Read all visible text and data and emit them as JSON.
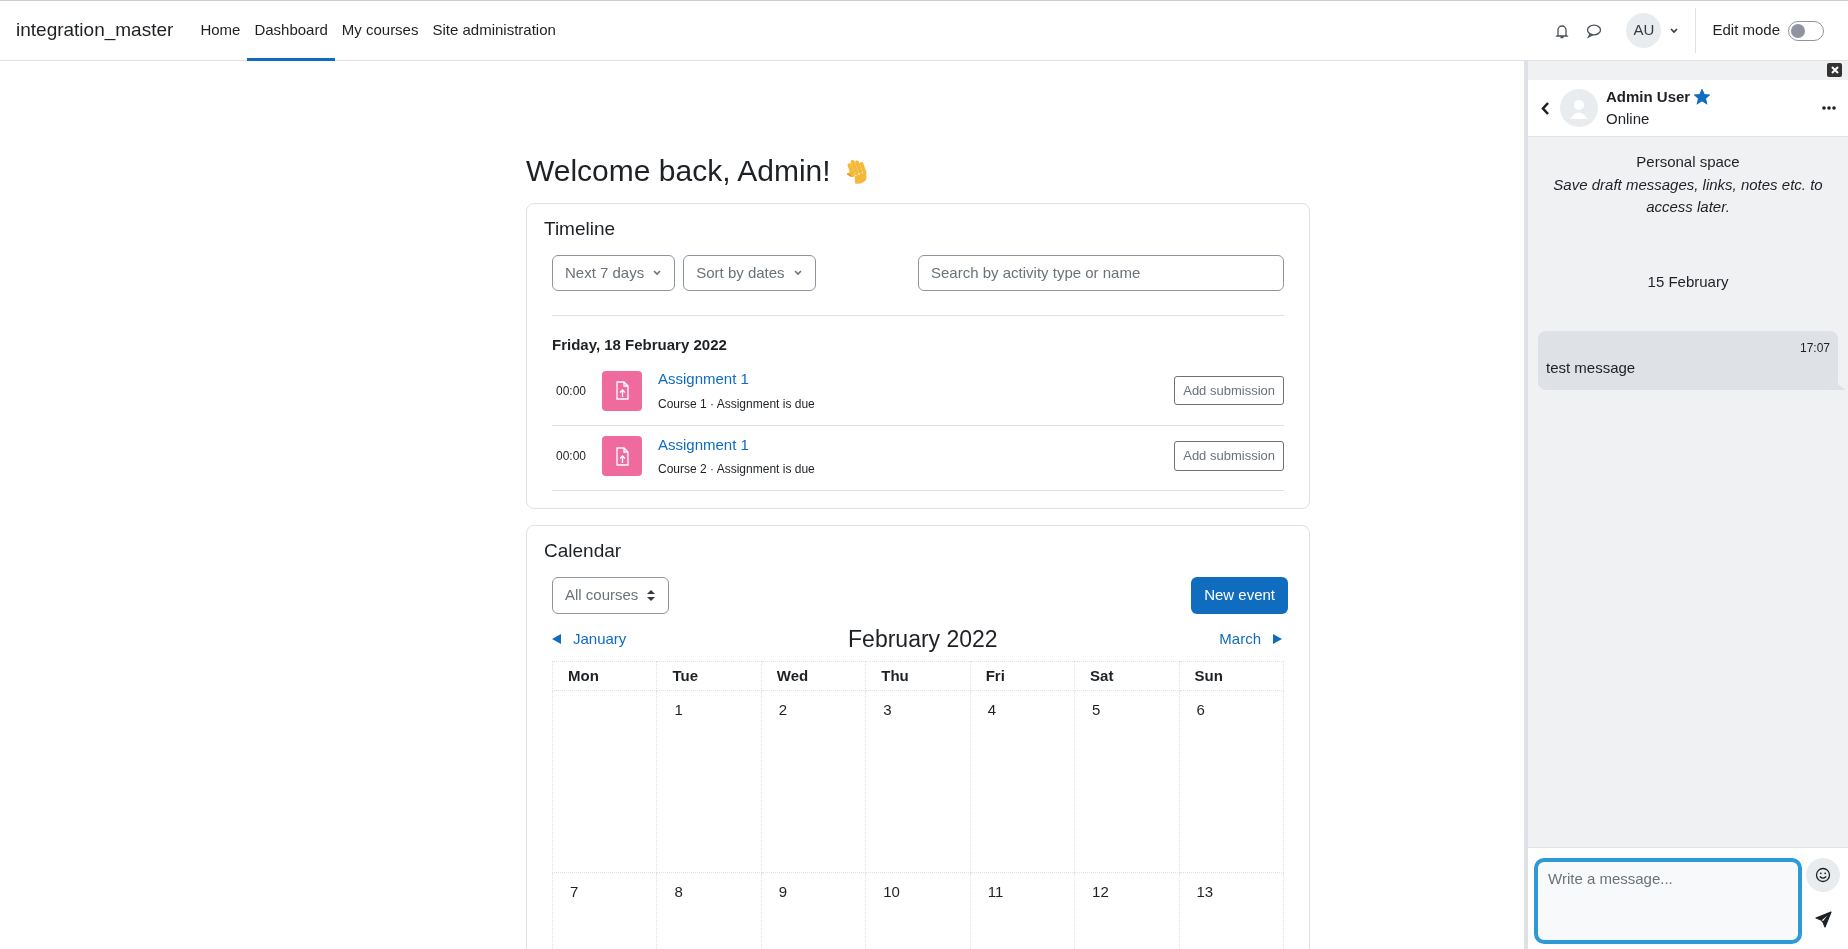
{
  "navbar": {
    "brand": "integration_master",
    "links": [
      {
        "label": "Home",
        "selected": false
      },
      {
        "label": "Dashboard",
        "selected": true
      },
      {
        "label": "My courses",
        "selected": false
      },
      {
        "label": "Site administration",
        "selected": false
      }
    ],
    "avatar": "AU",
    "edit_mode": {
      "label": "Edit mode",
      "on": false
    }
  },
  "welcome": "Welcome back, Admin!",
  "timeline": {
    "title": "Timeline",
    "filters": [
      "Next 7 days",
      "Sort by dates"
    ],
    "search": {
      "placeholder": "Search by activity type or name"
    },
    "date": "Friday, 18 February 2022",
    "events": [
      {
        "time": "00:00",
        "name": "Assignment 1",
        "details": "Course 1 · Assignment is due",
        "action": "Add submission"
      },
      {
        "time": "00:00",
        "name": "Assignment 1",
        "details": "Course 2 · Assignment is due",
        "action": "Add submission"
      }
    ]
  },
  "calendar": {
    "title": "Calendar",
    "course_filter": "All courses",
    "new_event": "New event",
    "prev": "January",
    "month": "February 2022",
    "next": "March",
    "weekdays": [
      "Mon",
      "Tue",
      "Wed",
      "Thu",
      "Fri",
      "Sat",
      "Sun"
    ],
    "weeks": [
      [
        {
          "kind": "blank"
        },
        {
          "kind": "day",
          "label": "1"
        },
        {
          "kind": "day",
          "label": "2"
        },
        {
          "kind": "day",
          "label": "3"
        },
        {
          "kind": "day",
          "label": "4"
        },
        {
          "kind": "day",
          "label": "5"
        },
        {
          "kind": "day",
          "label": "6"
        }
      ],
      [
        {
          "kind": "day",
          "label": "7"
        },
        {
          "kind": "day",
          "label": "8"
        },
        {
          "kind": "day",
          "label": "9"
        },
        {
          "kind": "day",
          "label": "10"
        },
        {
          "kind": "day",
          "label": "11"
        },
        {
          "kind": "day",
          "label": "12"
        },
        {
          "kind": "day",
          "label": "13"
        }
      ]
    ]
  },
  "messages": {
    "contact": {
      "name": "Admin User",
      "starred": true,
      "status": "Online"
    },
    "intro": {
      "title": "Personal space",
      "text": "Save draft messages, links, notes etc. to access later."
    },
    "day": "15 February",
    "items": [
      {
        "time": "17:07",
        "text": "test message"
      }
    ],
    "composer": {
      "placeholder": "Write a message..."
    }
  }
}
